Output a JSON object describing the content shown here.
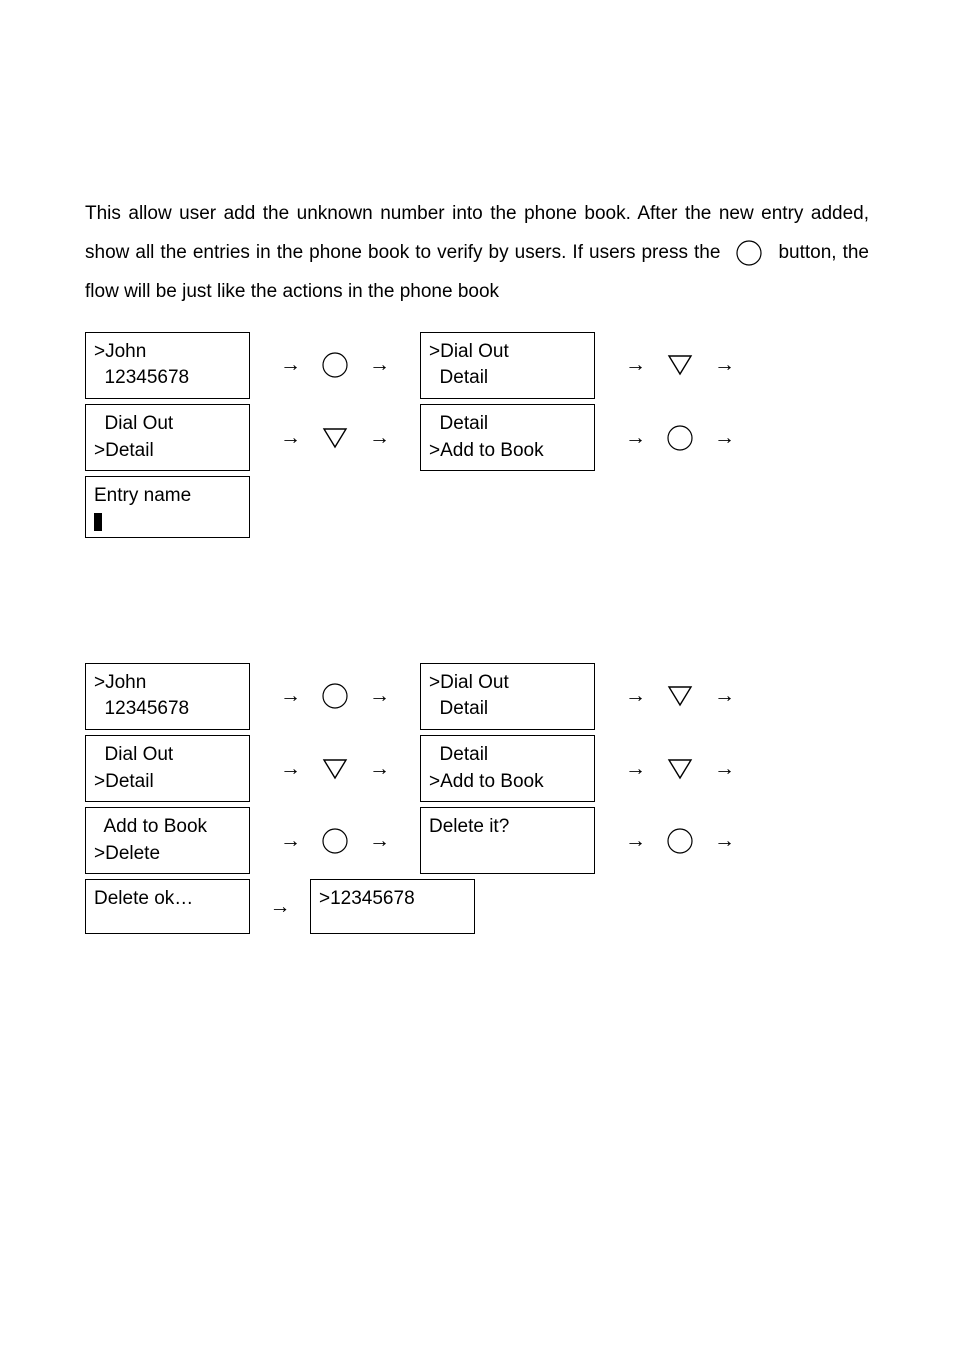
{
  "intro": {
    "part1": "This allow user add the unknown number into the phone book. After the new entry added, show all the entries in the phone book to verify by users. If users press the",
    "part2": "button, the flow will be just like the actions in the phone book"
  },
  "icons": {
    "circle": "circle-button-icon",
    "down": "down-triangle-icon"
  },
  "flow1": {
    "r1": {
      "screenA": ">John\n  12345678",
      "btn": "circle",
      "screenB": ">Dial Out\n  Detail",
      "btn2": "down"
    },
    "r2": {
      "screenA": "  Dial Out\n>Detail",
      "btn": "down",
      "screenB": "  Detail\n>Add to Book",
      "btn2": "circle"
    },
    "r3": {
      "screenA_label": "Entry name"
    }
  },
  "flow2": {
    "r1": {
      "screenA": ">John\n  12345678",
      "btn": "circle",
      "screenB": ">Dial Out\n  Detail",
      "btn2": "down"
    },
    "r2": {
      "screenA": "  Dial Out\n>Detail",
      "btn": "down",
      "screenB": "  Detail\n>Add to Book",
      "btn2": "down"
    },
    "r3": {
      "screenA": "  Add to Book\n>Delete",
      "btn": "circle",
      "screenB": "Delete it?",
      "btn2": "circle"
    },
    "r4": {
      "screenA": "Delete ok…",
      "screenB": ">12345678"
    }
  }
}
